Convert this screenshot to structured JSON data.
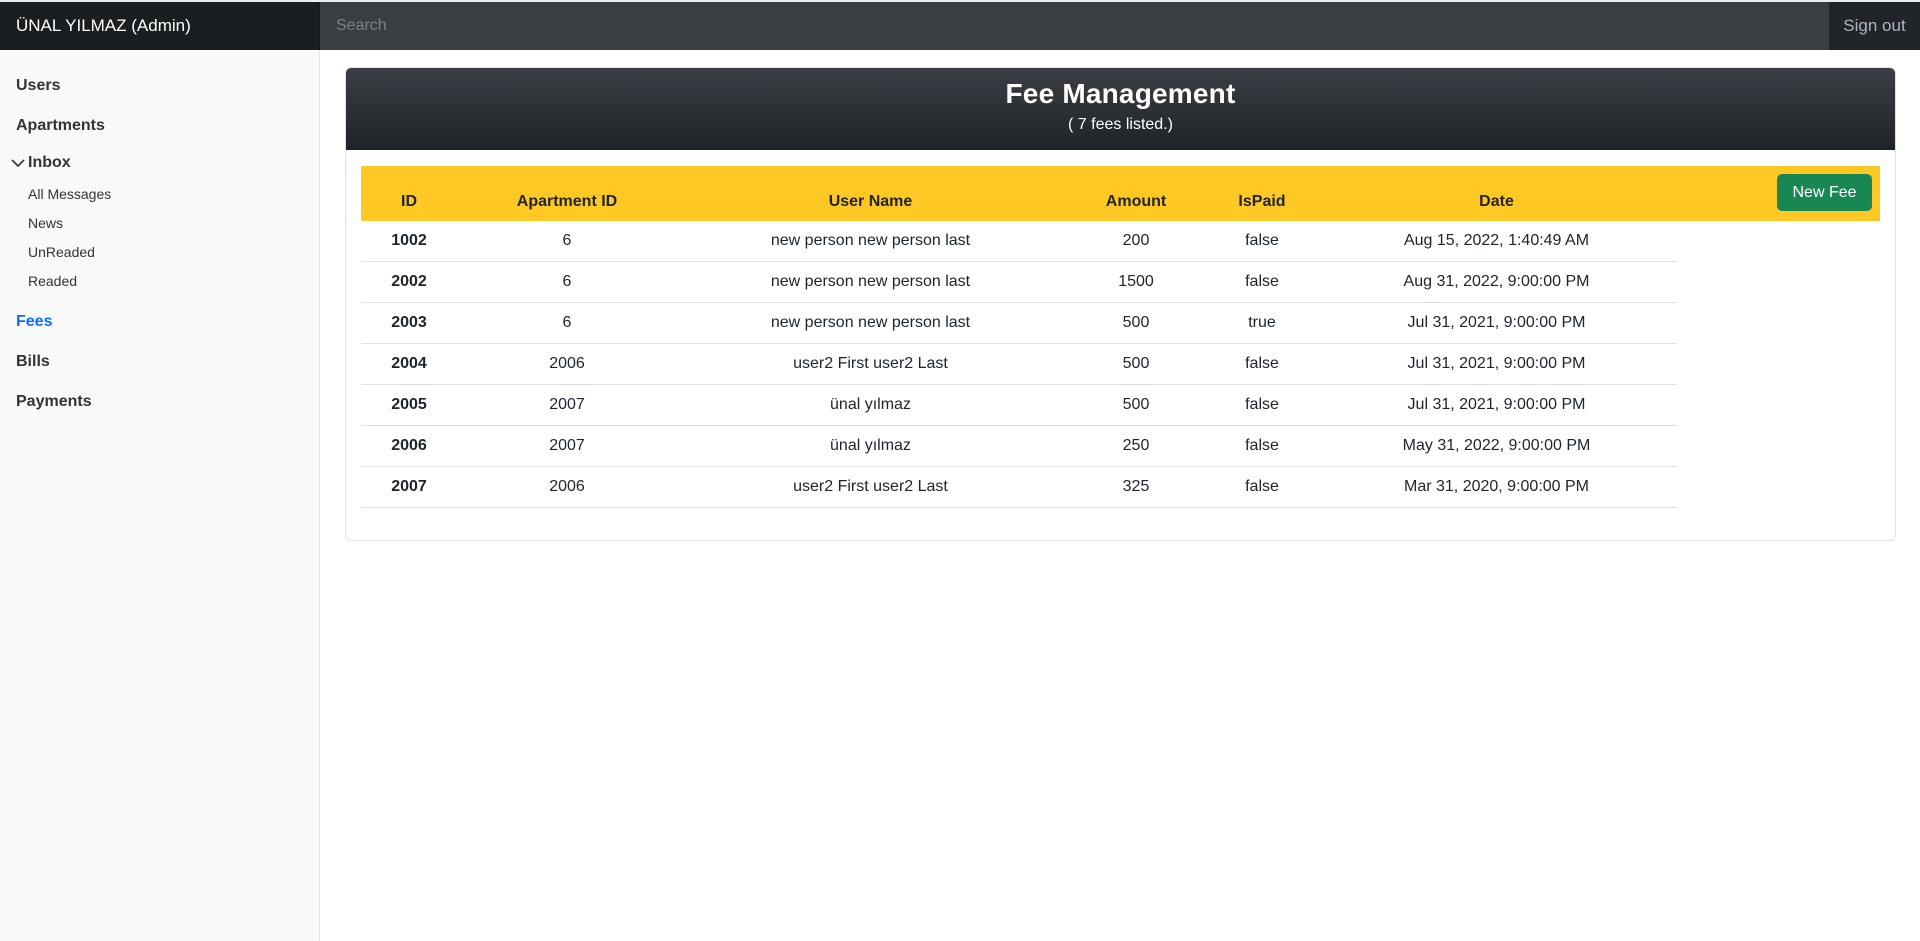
{
  "topbar": {
    "brand": "ÜNAL YILMAZ (Admin)",
    "search_placeholder": "Search",
    "signout_label": "Sign out"
  },
  "sidebar": {
    "users": "Users",
    "apartments": "Apartments",
    "inbox": "Inbox",
    "inbox_items": [
      "All Messages",
      "News",
      "UnReaded",
      "Readed"
    ],
    "fees": "Fees",
    "bills": "Bills",
    "payments": "Payments"
  },
  "card": {
    "title": "Fee Management",
    "subtitle": "( 7 fees listed.)",
    "new_fee_label": "New Fee"
  },
  "table": {
    "headers": [
      "ID",
      "Apartment ID",
      "User Name",
      "Amount",
      "IsPaid",
      "Date"
    ],
    "rows": [
      [
        "1002",
        "6",
        "new person new person last",
        "200",
        "false",
        "Aug 15, 2022, 1:40:49 AM"
      ],
      [
        "2002",
        "6",
        "new person new person last",
        "1500",
        "false",
        "Aug 31, 2022, 9:00:00 PM"
      ],
      [
        "2003",
        "6",
        "new person new person last",
        "500",
        "true",
        "Jul 31, 2021, 9:00:00 PM"
      ],
      [
        "2004",
        "2006",
        "user2 First user2 Last",
        "500",
        "false",
        "Jul 31, 2021, 9:00:00 PM"
      ],
      [
        "2005",
        "2007",
        "ünal yılmaz",
        "500",
        "false",
        "Jul 31, 2021, 9:00:00 PM"
      ],
      [
        "2006",
        "2007",
        "ünal yılmaz",
        "250",
        "false",
        "May 31, 2022, 9:00:00 PM"
      ],
      [
        "2007",
        "2006",
        "user2 First user2 Last",
        "325",
        "false",
        "Mar 31, 2020, 9:00:00 PM"
      ]
    ]
  }
}
